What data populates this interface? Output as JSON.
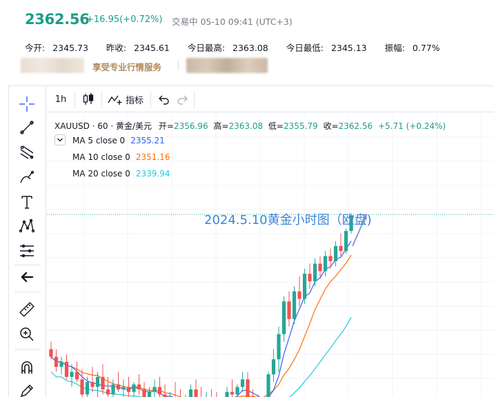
{
  "quote": {
    "price": "2362.56",
    "change": "+16.95(+0.72%)",
    "status": "交易中 05-10 09:41 (UTC+3)",
    "stats": [
      {
        "label": "今开:",
        "value": "2345.73"
      },
      {
        "label": "昨收:",
        "value": "2345.61"
      },
      {
        "label": "今日最高:",
        "value": "2363.08"
      },
      {
        "label": "今日最低:",
        "value": "2345.13"
      },
      {
        "label": "振幅:",
        "value": "0.77%"
      }
    ],
    "promo": "享受专业行情服务"
  },
  "toolbar": {
    "interval": "1h",
    "indicators": "指标"
  },
  "left_tools": [
    "crosshair-icon",
    "trend-line-icon",
    "fib-icon",
    "brush-icon",
    "text-icon",
    "pattern-icon",
    "measure-lines-icon",
    "back-arrow-icon",
    "ruler-icon",
    "zoom-in-icon",
    "magnet-icon",
    "lock-pencil-icon"
  ],
  "legend": {
    "symbol": "XAUUSD · 60 · 黄金/美元",
    "open_label": "开=",
    "open": "2356.96",
    "high_label": "高=",
    "high": "2363.08",
    "low_label": "低=",
    "low": "2355.79",
    "close_label": "收=",
    "close": "2362.56",
    "chg": "+5.71 (+0.24%)"
  },
  "ma": [
    {
      "label": "MA 5 close 0",
      "value": "2355.21",
      "color": "#2962ff"
    },
    {
      "label": "MA 10 close 0",
      "value": "2351.16",
      "color": "#ff6d00"
    },
    {
      "label": "MA 20 close 0",
      "value": "2339.94",
      "color": "#26c6da"
    }
  ],
  "annotation": "2024.5.10黄金小时图（欧盘)",
  "colors": {
    "up": "#26a69a",
    "down": "#ef5350",
    "accent": "#1f9b8a",
    "annotation": "#3d86d6"
  },
  "chart_data": {
    "type": "candlestick",
    "ylim": [
      2290,
      2370
    ],
    "last_price_line": 2362.56,
    "candles": [
      [
        2309,
        2312,
        2305,
        2306
      ],
      [
        2306,
        2309,
        2300,
        2302
      ],
      [
        2302,
        2306,
        2299,
        2304
      ],
      [
        2304,
        2307,
        2297,
        2298
      ],
      [
        2298,
        2303,
        2294,
        2300
      ],
      [
        2300,
        2304,
        2296,
        2297
      ],
      [
        2297,
        2301,
        2289,
        2291
      ],
      [
        2291,
        2298,
        2288,
        2296
      ],
      [
        2296,
        2302,
        2292,
        2294
      ],
      [
        2294,
        2300,
        2289,
        2298
      ],
      [
        2298,
        2303,
        2291,
        2293
      ],
      [
        2293,
        2298,
        2287,
        2291
      ],
      [
        2291,
        2297,
        2289,
        2295
      ],
      [
        2295,
        2300,
        2292,
        2293
      ],
      [
        2293,
        2297,
        2288,
        2294
      ],
      [
        2294,
        2298,
        2290,
        2292
      ],
      [
        2292,
        2296,
        2289,
        2295
      ],
      [
        2295,
        2299,
        2291,
        2293
      ],
      [
        2293,
        2296,
        2286,
        2288
      ],
      [
        2288,
        2294,
        2285,
        2292
      ],
      [
        2292,
        2297,
        2289,
        2294
      ],
      [
        2294,
        2298,
        2290,
        2291
      ],
      [
        2291,
        2295,
        2283,
        2285
      ],
      [
        2285,
        2292,
        2282,
        2290
      ],
      [
        2290,
        2296,
        2286,
        2288
      ],
      [
        2288,
        2293,
        2282,
        2284
      ],
      [
        2284,
        2291,
        2283,
        2289
      ],
      [
        2289,
        2295,
        2286,
        2293
      ],
      [
        2293,
        2297,
        2288,
        2290
      ],
      [
        2290,
        2294,
        2285,
        2287
      ],
      [
        2287,
        2292,
        2284,
        2290
      ],
      [
        2290,
        2293,
        2286,
        2288
      ],
      [
        2288,
        2292,
        2285,
        2286
      ],
      [
        2286,
        2290,
        2283,
        2289
      ],
      [
        2289,
        2294,
        2287,
        2292
      ],
      [
        2292,
        2297,
        2289,
        2291
      ],
      [
        2291,
        2295,
        2287,
        2294
      ],
      [
        2294,
        2300,
        2292,
        2297
      ],
      [
        2297,
        2300,
        2288,
        2289
      ],
      [
        2289,
        2293,
        2285,
        2287
      ],
      [
        2287,
        2291,
        2283,
        2285
      ],
      [
        2285,
        2290,
        2282,
        2288
      ],
      [
        2288,
        2300,
        2287,
        2299
      ],
      [
        2299,
        2309,
        2296,
        2305
      ],
      [
        2305,
        2318,
        2300,
        2315
      ],
      [
        2315,
        2330,
        2312,
        2328
      ],
      [
        2328,
        2332,
        2318,
        2321
      ],
      [
        2321,
        2334,
        2319,
        2332
      ],
      [
        2332,
        2338,
        2326,
        2329
      ],
      [
        2329,
        2341,
        2327,
        2339
      ],
      [
        2339,
        2343,
        2333,
        2336
      ],
      [
        2336,
        2345,
        2334,
        2343
      ],
      [
        2343,
        2346,
        2337,
        2340
      ],
      [
        2340,
        2348,
        2338,
        2346
      ],
      [
        2346,
        2349,
        2341,
        2344
      ],
      [
        2344,
        2352,
        2342,
        2350
      ],
      [
        2350,
        2355,
        2346,
        2348
      ],
      [
        2348,
        2357,
        2347,
        2356
      ],
      [
        2356,
        2363,
        2355,
        2362
      ]
    ]
  }
}
